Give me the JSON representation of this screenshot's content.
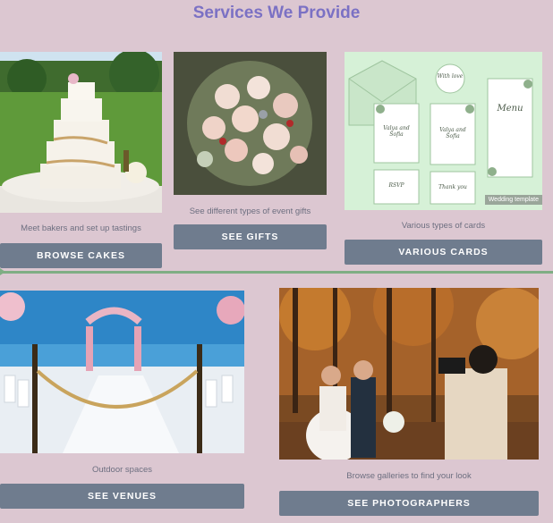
{
  "page": {
    "title": "Services We Provide"
  },
  "services": [
    {
      "caption": "Meet bakers and set up tastings",
      "button": "BROWSE CAKES"
    },
    {
      "caption": "See different types of event gifts",
      "button": "SEE GIFTS"
    },
    {
      "caption": "Various types of cards",
      "button": "VARIOUS CARDS",
      "image_label": "Wedding template"
    },
    {
      "caption": "Outdoor spaces",
      "button": "SEE VENUES"
    },
    {
      "caption": "Browse galleries to find your look",
      "button": "SEE PHOTOGRAPHERS"
    }
  ],
  "cards_text": {
    "seal": "With love",
    "card1": "Valya and Sofia",
    "card2": "Valya and Sofia",
    "menu": "Menu",
    "rsvp": "RSVP",
    "thanks": "Thank you"
  },
  "colors": {
    "background": "#dcc7d1",
    "title": "#7b71c4",
    "button": "#6f7c8e",
    "divider": "#7fae84"
  }
}
